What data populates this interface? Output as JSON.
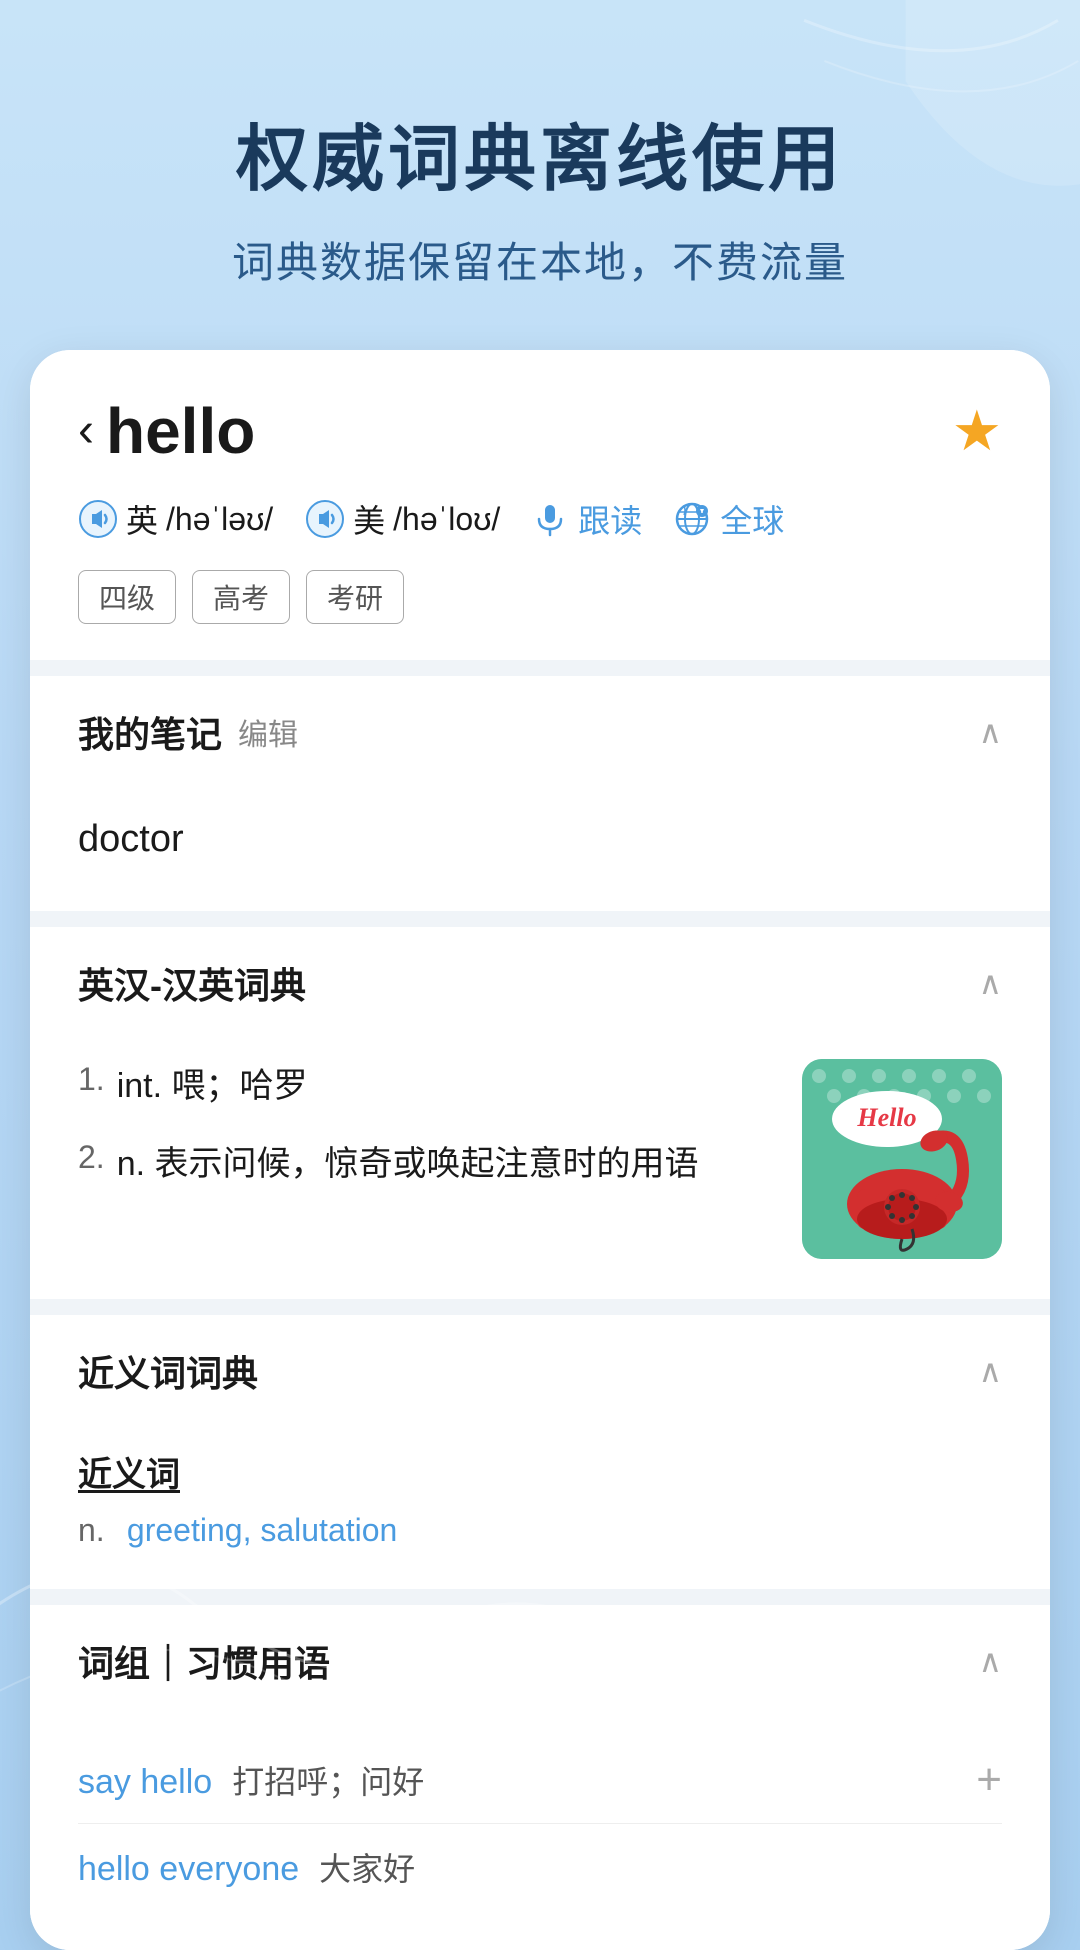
{
  "header": {
    "title": "权威词典离线使用",
    "subtitle": "词典数据保留在本地，不费流量"
  },
  "word": {
    "back_label": "‹",
    "term": "hello",
    "star": "★",
    "pronunciations": [
      {
        "flag": "英",
        "ipa": "/həˈləʊ/"
      },
      {
        "flag": "美",
        "ipa": "/həˈloʊ/"
      }
    ],
    "follow_label": "跟读",
    "global_label": "全球",
    "tags": [
      "四级",
      "高考",
      "考研"
    ]
  },
  "sections": {
    "notes": {
      "title": "我的笔记",
      "edit_label": "编辑",
      "content_word": "doctor"
    },
    "dict": {
      "title": "英汉-汉英词典",
      "definitions": [
        {
          "num": "1.",
          "type": "int.",
          "meaning": "喂；哈罗"
        },
        {
          "num": "2.",
          "type": "n.",
          "meaning": "表示问候，惊奇或唤起注意时的用语"
        }
      ]
    },
    "synonym": {
      "title": "近义词词典",
      "section_label": "近义词",
      "entries": [
        {
          "pos": "n.",
          "words": "greeting, salutation"
        }
      ]
    },
    "phrases": {
      "title": "词组｜习惯用语",
      "items": [
        {
          "en": "say hello",
          "cn": "打招呼；问好",
          "has_plus": true
        },
        {
          "en": "hello everyone",
          "cn": "大家好",
          "has_plus": false
        }
      ]
    }
  },
  "colors": {
    "blue_accent": "#4a9be0",
    "star_yellow": "#f5a623",
    "bg_top": "#c8e4f8",
    "text_dark": "#1a3a5c"
  }
}
